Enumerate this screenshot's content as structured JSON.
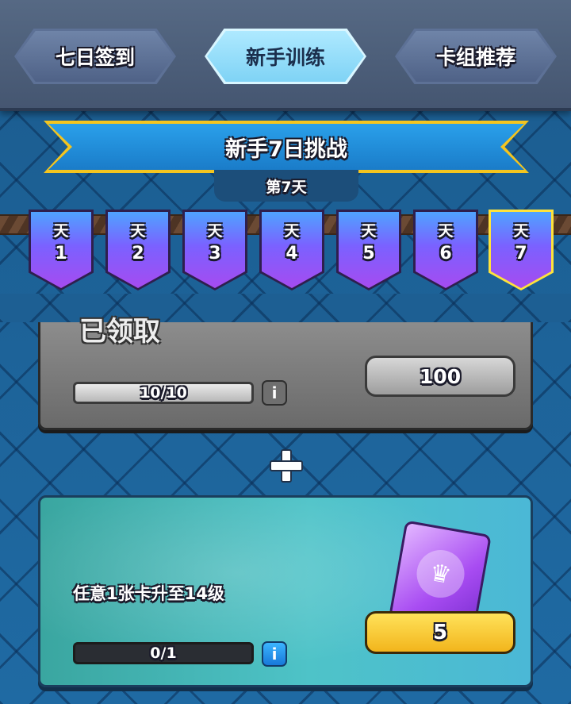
{
  "tabs": [
    {
      "label": "七日签到",
      "active": false
    },
    {
      "label": "新手训练",
      "active": true
    },
    {
      "label": "卡组推荐",
      "active": false
    }
  ],
  "ribbon": {
    "title": "新手7日挑战",
    "current_day": "第7天"
  },
  "days": [
    {
      "top": "天",
      "num": "1"
    },
    {
      "top": "天",
      "num": "2"
    },
    {
      "top": "天",
      "num": "3"
    },
    {
      "top": "天",
      "num": "4"
    },
    {
      "top": "天",
      "num": "5"
    },
    {
      "top": "天",
      "num": "6"
    },
    {
      "top": "天",
      "num": "7"
    }
  ],
  "completed_task": {
    "status": "已领取",
    "progress_text": "10/10",
    "progress": 1.0,
    "reward": "100",
    "info_icon": "i"
  },
  "plus_icon": "plus-icon",
  "active_task": {
    "description": "任意1张卡升至14级",
    "progress_text": "0/1",
    "progress": 0.0,
    "reward": "5",
    "info_icon": "i"
  },
  "colors": {
    "accent": "#f4c51f",
    "tab_active": "#aee9ff",
    "ribbon": "#1a7cc9"
  }
}
